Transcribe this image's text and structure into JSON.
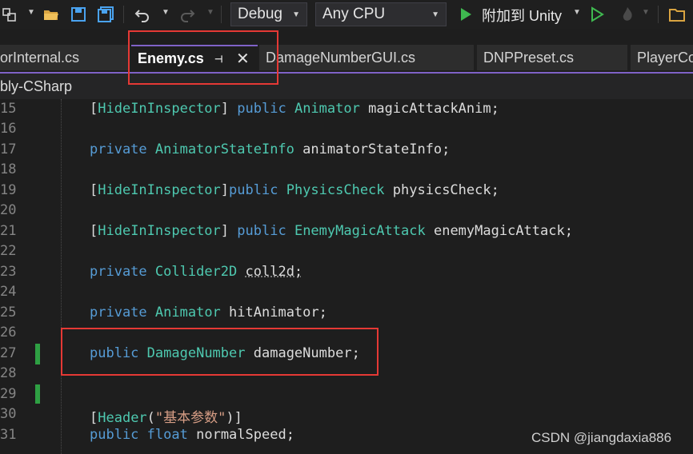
{
  "toolbar": {
    "config": "Debug",
    "platform": "Any CPU",
    "attach_label": "附加到 Unity",
    "icons": [
      "solution-icon",
      "open-folder-icon",
      "save-icon",
      "save-all-icon",
      "undo-icon",
      "redo-icon",
      "run-icon",
      "start-without-debug-icon",
      "hot-reload-icon",
      "folder-icon"
    ]
  },
  "tabs": [
    {
      "label": "orInternal.cs",
      "active": false
    },
    {
      "label": "Enemy.cs",
      "active": true
    },
    {
      "label": "DamageNumberGUI.cs",
      "active": false
    },
    {
      "label": "DNPPreset.cs",
      "active": false
    },
    {
      "label": "PlayerCo",
      "active": false
    }
  ],
  "nav": {
    "project": "bly-CSharp"
  },
  "editor": {
    "line_numbers": [
      "15",
      "16",
      "17",
      "18",
      "19",
      "20",
      "21",
      "22",
      "23",
      "24",
      "25",
      "26",
      "27",
      "28",
      "29",
      "30",
      "31"
    ],
    "lines": {
      "l15": {
        "attr": "HideInInspector",
        "kw": "public",
        "type": "Animator",
        "name": "magicAttackAnim;"
      },
      "l17": {
        "kw": "private",
        "type": "AnimatorStateInfo",
        "name": "animatorStateInfo;"
      },
      "l19": {
        "attr": "HideInInspector",
        "kw": "public",
        "type": "PhysicsCheck",
        "name": "physicsCheck;"
      },
      "l21": {
        "attr": "HideInInspector",
        "kw": "public",
        "type": "EnemyMagicAttack",
        "name": "enemyMagicAttack;"
      },
      "l23": {
        "kw": "private",
        "type": "Collider2D",
        "name": "coll2d;"
      },
      "l25": {
        "kw": "private",
        "type": "Animator",
        "name": "hitAnimator;"
      },
      "l27": {
        "kw": "public",
        "type": "DamageNumber",
        "name": "damageNumber;"
      },
      "l30": {
        "attr": "Header",
        "arg": "\"基本参数\""
      },
      "l31": {
        "kw1": "public",
        "kw2": "float",
        "name": "normalSpeed;"
      }
    }
  },
  "watermark": "CSDN @jiangdaxia886",
  "colors": {
    "accent": "#7f62c7",
    "highlight_box": "#e53935",
    "keyword": "#569cd6",
    "type": "#4ec9b0",
    "change_bar": "#2ea043"
  }
}
